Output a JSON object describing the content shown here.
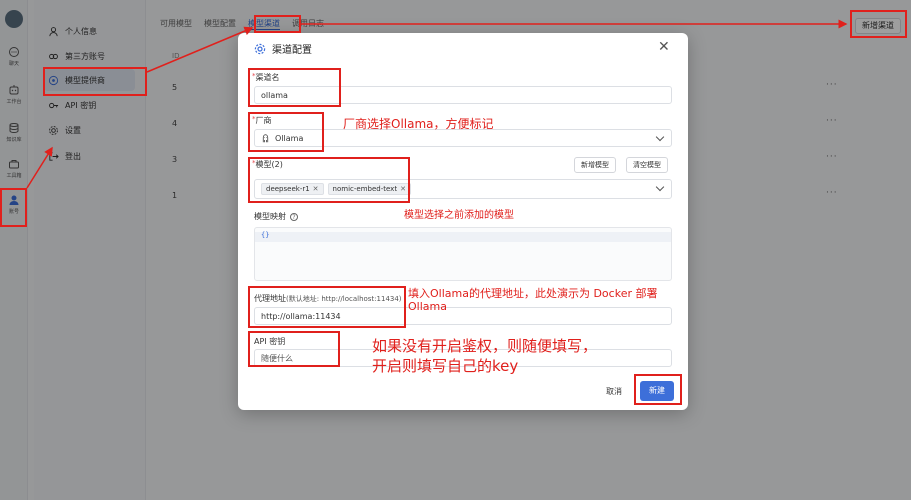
{
  "rail": {
    "items": [
      {
        "label": "聊天",
        "icon": "chat-icon"
      },
      {
        "label": "工作台",
        "icon": "robot-icon"
      },
      {
        "label": "知识库",
        "icon": "database-icon"
      },
      {
        "label": "工具箱",
        "icon": "toolbox-icon"
      },
      {
        "label": "账号",
        "icon": "user-icon"
      }
    ]
  },
  "sidebar": {
    "items": [
      {
        "label": "个人信息",
        "icon": "person-icon"
      },
      {
        "label": "第三方账号",
        "icon": "link-icon"
      },
      {
        "label": "模型提供商",
        "icon": "model-icon"
      },
      {
        "label": "API 密钥",
        "icon": "key-icon"
      },
      {
        "label": "设置",
        "icon": "gear-icon"
      },
      {
        "label": "登出",
        "icon": "logout-icon"
      }
    ]
  },
  "tabs": [
    {
      "label": "可用模型"
    },
    {
      "label": "模型配置"
    },
    {
      "label": "模型渠道"
    },
    {
      "label": "调用日志"
    }
  ],
  "toolbar": {
    "new_channel_label": "新增渠道"
  },
  "table": {
    "id_header": "ID",
    "rows": [
      {
        "id": "5"
      },
      {
        "id": "4"
      },
      {
        "id": "3"
      },
      {
        "id": "1"
      }
    ],
    "more_label": "···"
  },
  "modal": {
    "title": "渠道配置",
    "close_label": "✕",
    "channel_name": {
      "required": "*",
      "label": "渠道名",
      "value": "ollama"
    },
    "vendor": {
      "required": "*",
      "label": "厂商",
      "value": "Ollama"
    },
    "models": {
      "required": "*",
      "label": "模型(2)",
      "add_label": "新增模型",
      "clear_label": "清空模型",
      "chips": [
        "deepseek-r1",
        "nomic-embed-text"
      ],
      "chip_remove": "✕"
    },
    "model_mapping": {
      "label": "模型映射",
      "value": "{}"
    },
    "proxy": {
      "label": "代理地址",
      "hint": "(默认地址: http://localhost:11434)",
      "value": "http://ollama:11434"
    },
    "api_key": {
      "label": "API 密钥",
      "placeholder": "随便什么"
    },
    "cancel_label": "取消",
    "create_label": "新建"
  },
  "annotations": {
    "vendor_note": "厂商选择Ollama，方便标记",
    "models_note": "模型选择之前添加的模型",
    "proxy_note_line1": "填入Ollama的代理地址，此处演示为 Docker 部署",
    "proxy_note_line2": "Ollama",
    "key_note_line1": "如果没有开启鉴权，则随便填写，",
    "key_note_line2": "开启则填写自己的key"
  },
  "colors": {
    "accent": "#3d6fd9",
    "annotation": "#e0201c"
  }
}
